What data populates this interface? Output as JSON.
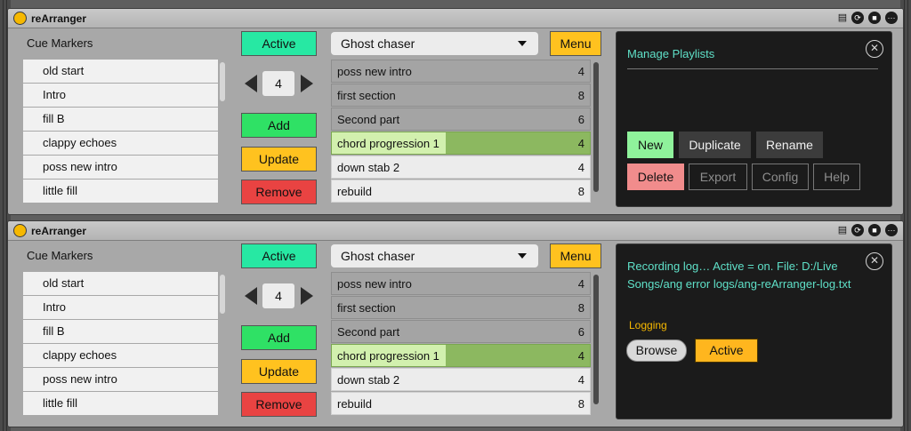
{
  "devices": [
    {
      "title": "reArranger",
      "cue_title": "Cue Markers",
      "cues": [
        "old start",
        "Intro",
        "fill B",
        "clappy echoes",
        "poss new intro",
        "little fill"
      ],
      "active_label": "Active",
      "stepper_value": "4",
      "add_label": "Add",
      "update_label": "Update",
      "remove_label": "Remove",
      "playlist_selected": "Ghost chaser",
      "menu_label": "Menu",
      "sequence": [
        {
          "name": "poss new intro",
          "count": "4"
        },
        {
          "name": "first section",
          "count": "8"
        },
        {
          "name": "Second part",
          "count": "6"
        },
        {
          "name": "chord progression 1",
          "count": "4"
        },
        {
          "name": "down stab 2",
          "count": "4"
        },
        {
          "name": "rebuild",
          "count": "8"
        }
      ],
      "panel": {
        "title": "Manage Playlists",
        "new_label": "New",
        "duplicate_label": "Duplicate",
        "rename_label": "Rename",
        "delete_label": "Delete",
        "export_label": "Export",
        "config_label": "Config",
        "help_label": "Help"
      }
    },
    {
      "title": "reArranger",
      "cue_title": "Cue Markers",
      "cues": [
        "old start",
        "Intro",
        "fill B",
        "clappy echoes",
        "poss new intro",
        "little fill"
      ],
      "active_label": "Active",
      "stepper_value": "4",
      "add_label": "Add",
      "update_label": "Update",
      "remove_label": "Remove",
      "playlist_selected": "Ghost chaser",
      "menu_label": "Menu",
      "sequence": [
        {
          "name": "poss new intro",
          "count": "4"
        },
        {
          "name": "first section",
          "count": "8"
        },
        {
          "name": "Second part",
          "count": "6"
        },
        {
          "name": "chord progression 1",
          "count": "4"
        },
        {
          "name": "down stab 2",
          "count": "4"
        },
        {
          "name": "rebuild",
          "count": "8"
        }
      ],
      "panel": {
        "log_text": "Recording log… Active = on. File: D:/Live Songs/ang error logs/ang-reArranger-log.txt",
        "logging_label": "Logging",
        "browse_label": "Browse",
        "active_label": "Active"
      }
    }
  ],
  "colors": {
    "active_green": "#27e8a3",
    "add_green": "#2fe165",
    "update_yellow": "#ffc21f",
    "remove_red": "#e94342",
    "panel_text": "#5fe0c8",
    "highlight_row": "#8cb860"
  },
  "icons": [
    "power-icon",
    "clip-icon",
    "refresh-icon",
    "save-icon",
    "more-icon",
    "close-icon",
    "chevron-down-icon",
    "arrow-left-icon",
    "arrow-right-icon"
  ]
}
